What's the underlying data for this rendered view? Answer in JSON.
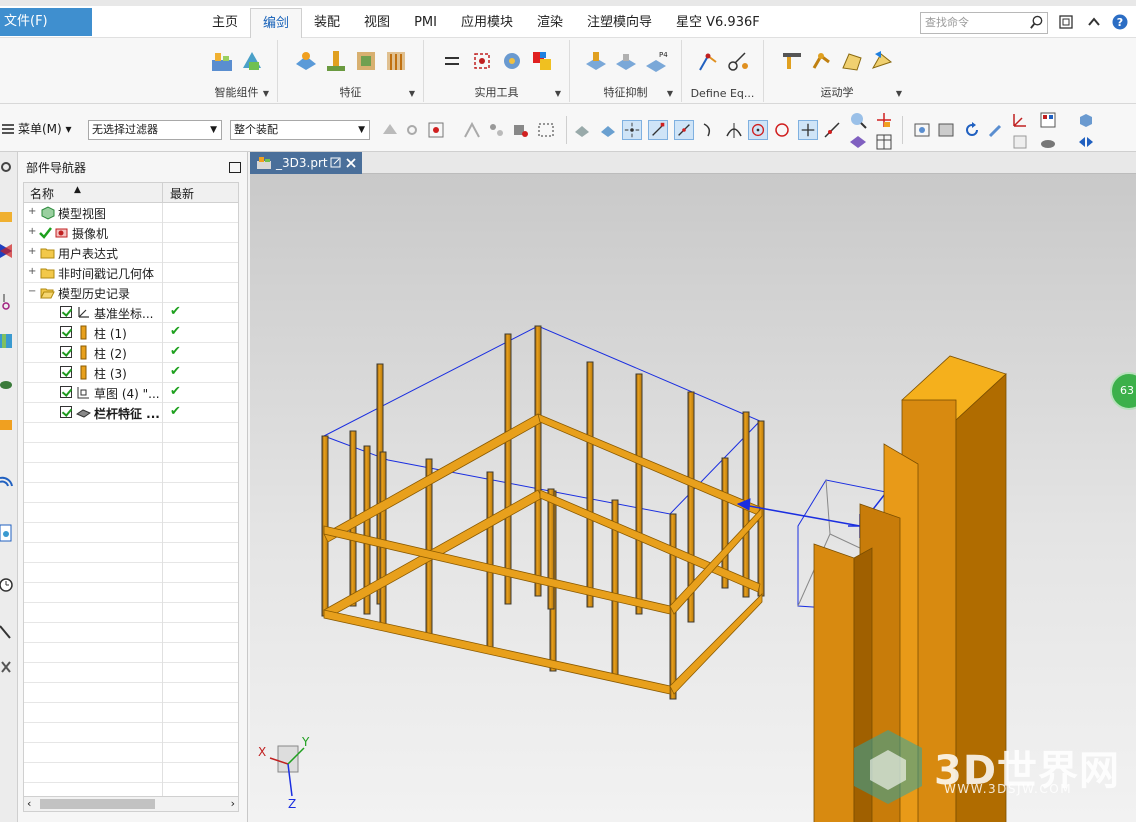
{
  "file_menu": "文件(F)",
  "tabs": [
    "主页",
    "编剑",
    "装配",
    "视图",
    "PMI",
    "应用模块",
    "渲染",
    "注塑模向导",
    "星空 V6.936F"
  ],
  "active_tab": "编剑",
  "search_placeholder": "查找命令",
  "ribbon_groups": [
    {
      "label": "智能组件",
      "icons": [
        "smart-component-icon",
        "smart-component-2-icon"
      ]
    },
    {
      "label": "特征",
      "icons": [
        "feature-icon",
        "feature-2-icon",
        "feature-3-icon",
        "feature-4-icon"
      ]
    },
    {
      "label": "实用工具",
      "icons": [
        "equal-icon",
        "utility-2-icon",
        "utility-3-icon",
        "utility-4-icon"
      ]
    },
    {
      "label": "特征抑制",
      "icons": [
        "suppress-icon",
        "suppress-2-icon",
        "suppress-p4-icon"
      ]
    },
    {
      "label": "Define Eq...",
      "icons": [
        "define-eq-icon",
        "define-eq-2-icon"
      ]
    },
    {
      "label": "运动学",
      "icons": [
        "kinematics-icon",
        "kinematics-2-icon",
        "kinematics-3-icon",
        "kinematics-4-icon"
      ]
    }
  ],
  "toolbar": {
    "menu_label": "菜单(M)",
    "filter_value": "无选择过滤器",
    "scope_value": "整个装配"
  },
  "navigator": {
    "title": "部件导航器",
    "col_name": "名称",
    "col_latest": "最新",
    "rows": [
      {
        "label": "模型视图",
        "latest": ""
      },
      {
        "label": "摄像机",
        "latest": ""
      },
      {
        "label": "用户表达式",
        "latest": ""
      },
      {
        "label": "非时间戳记几何体",
        "latest": ""
      },
      {
        "label": "模型历史记录",
        "latest": ""
      },
      {
        "label": "基准坐标...",
        "latest": "✔"
      },
      {
        "label": "柱 (1)",
        "latest": "✔"
      },
      {
        "label": "柱 (2)",
        "latest": "✔"
      },
      {
        "label": "柱 (3)",
        "latest": "✔"
      },
      {
        "label": "草图 (4) \"...",
        "latest": "✔"
      },
      {
        "label": "栏杆特征 ...",
        "latest": "✔"
      }
    ]
  },
  "document_tab": "_3D3.prt",
  "triad_labels": {
    "x": "X",
    "y": "Y",
    "z": "Z"
  },
  "handle_axis_label": "Z",
  "side_badge": "63",
  "watermark": {
    "title": "3D世界网",
    "url": "WWW.3DSJW.COM"
  },
  "colors": {
    "accent": "#3f8fcf",
    "wood": "#e8a01c",
    "wood_dark": "#c97d06",
    "post_dark": "#5a4a2a",
    "selection": "#1a2ee0"
  }
}
